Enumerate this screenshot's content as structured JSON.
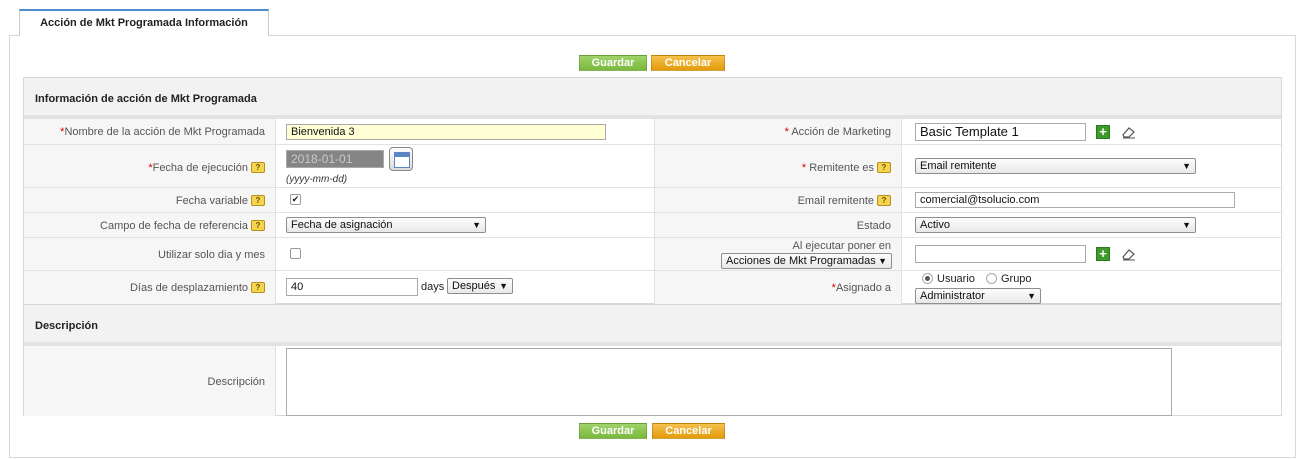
{
  "tab": {
    "label": "Acción de Mkt Programada Información"
  },
  "buttons": {
    "save": "Guardar",
    "cancel": "Cancelar"
  },
  "section_info": {
    "title": "Información de acción de Mkt Programada"
  },
  "fields": {
    "nombre": {
      "label": "Nombre de la acción de Mkt Programada",
      "required_mark": "*",
      "value": "Bienvenida 3"
    },
    "fecha_ejecucion": {
      "label": "Fecha de ejecución",
      "required_mark": "*",
      "value": "2018-01-01",
      "format_hint": "(yyyy-mm-dd)"
    },
    "fecha_variable": {
      "label": "Fecha variable",
      "checked": true
    },
    "campo_fecha_ref": {
      "label": "Campo de fecha de referencia",
      "value": "Fecha de asignación"
    },
    "solo_dia_mes": {
      "label": "Utilizar solo dia y mes",
      "checked": false
    },
    "dias_desplazamiento": {
      "label": "Días de desplazamiento",
      "value": "40",
      "unit": "days",
      "direction": "Después"
    },
    "accion_marketing": {
      "label": "Acción de Marketing",
      "required_mark": "*",
      "value": "Basic Template 1"
    },
    "remitente_es": {
      "label": "Remitente es",
      "required_mark": "*",
      "value": "Email remitente"
    },
    "email_remitente": {
      "label": "Email remitente",
      "value": "comercial@tsolucio.com"
    },
    "estado": {
      "label": "Estado",
      "value": "Activo"
    },
    "al_ejecutar": {
      "label": "Al ejecutar poner en",
      "module": "Acciones de Mkt Programadas",
      "value": ""
    },
    "asignado": {
      "label": "Asignado a",
      "required_mark": "*",
      "radio_user": "Usuario",
      "radio_group": "Grupo",
      "value": "Administrator"
    }
  },
  "section_desc": {
    "title": "Descripción",
    "label": "Descripción",
    "value": ""
  },
  "icons": {
    "help": "help-balloon-icon",
    "add": "plus-icon",
    "clear": "eraser-icon",
    "calendar": "calendar-icon"
  },
  "colors": {
    "save": "#7bb83d",
    "cancel": "#e49b0b",
    "tab_accent": "#4e8ccf",
    "required": "#dd0000"
  }
}
